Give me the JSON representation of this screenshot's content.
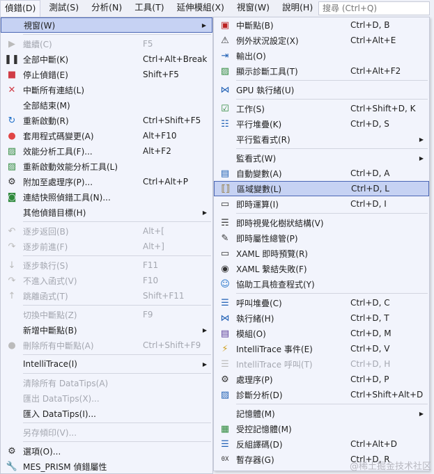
{
  "menubar": [
    "偵錯(D)",
    "測試(S)",
    "分析(N)",
    "工具(T)",
    "延伸模組(X)",
    "視窗(W)",
    "說明(H)"
  ],
  "search": {
    "placeholder": "搜尋 (Ctrl+Q)"
  },
  "left_menu": [
    {
      "label": "視窗(W)",
      "icon": "",
      "submenu": true,
      "highlight": true
    },
    {
      "sep": true
    },
    {
      "label": "繼續(C)",
      "shortcut": "F5",
      "icon": "play-icon",
      "disabled": true
    },
    {
      "label": "全部中斷(K)",
      "shortcut": "Ctrl+Alt+Break",
      "icon": "pause-icon"
    },
    {
      "label": "停止偵錯(E)",
      "shortcut": "Shift+F5",
      "icon": "stop-icon"
    },
    {
      "label": "中斷所有連結(L)",
      "icon": "close-icon"
    },
    {
      "label": "全部結束(M)",
      "icon": ""
    },
    {
      "label": "重新啟動(R)",
      "shortcut": "Ctrl+Shift+F5",
      "icon": "restart-icon"
    },
    {
      "label": "套用程式碼變更(A)",
      "shortcut": "Alt+F10",
      "icon": "hot-reload-icon"
    },
    {
      "label": "效能分析工具(F)...",
      "shortcut": "Alt+F2",
      "icon": "profiler-icon"
    },
    {
      "label": "重新啟動效能分析工具(L)",
      "icon": "profiler-icon"
    },
    {
      "label": "附加至處理序(P)...",
      "shortcut": "Ctrl+Alt+P",
      "icon": "gears-icon"
    },
    {
      "label": "連結快照偵錯工具(N)...",
      "icon": "snapshot-icon"
    },
    {
      "label": "其他偵錯目標(H)",
      "icon": "",
      "submenu": true
    },
    {
      "sep": true
    },
    {
      "label": "逐步返回(B)",
      "shortcut": "Alt+[",
      "icon": "step-back-icon",
      "disabled": true
    },
    {
      "label": "逐步前進(F)",
      "shortcut": "Alt+]",
      "icon": "step-forward-icon",
      "disabled": true
    },
    {
      "sep": true
    },
    {
      "label": "逐步執行(S)",
      "shortcut": "F11",
      "icon": "step-into-icon",
      "disabled": true
    },
    {
      "label": "不進入函式(V)",
      "shortcut": "F10",
      "icon": "step-over-icon",
      "disabled": true
    },
    {
      "label": "跳離函式(T)",
      "shortcut": "Shift+F11",
      "icon": "step-out-icon",
      "disabled": true
    },
    {
      "sep": true
    },
    {
      "label": "切換中斷點(Z)",
      "shortcut": "F9",
      "icon": "",
      "disabled": true
    },
    {
      "label": "新增中斷點(B)",
      "icon": "",
      "submenu": true
    },
    {
      "label": "刪除所有中斷點(A)",
      "shortcut": "Ctrl+Shift+F9",
      "icon": "delete-breakpoints-icon",
      "disabled": true
    },
    {
      "sep": true
    },
    {
      "label": "IntelliTrace(I)",
      "icon": "",
      "submenu": true
    },
    {
      "sep": true
    },
    {
      "label": "清除所有 DataTips(A)",
      "icon": "",
      "disabled": true
    },
    {
      "label": "匯出 DataTips(X)...",
      "icon": "",
      "disabled": true
    },
    {
      "label": "匯入 DataTips(I)...",
      "icon": ""
    },
    {
      "sep": true
    },
    {
      "label": "另存傾印(V)...",
      "icon": "",
      "disabled": true
    },
    {
      "sep": true
    },
    {
      "label": "選項(O)...",
      "icon": "gear-icon"
    },
    {
      "label": "MES_PRISM 偵錯屬性",
      "icon": "wrench-icon"
    }
  ],
  "right_menu": [
    {
      "label": "中斷點(B)",
      "shortcut": "Ctrl+D, B",
      "icon": "breakpoints-icon"
    },
    {
      "label": "例外狀況設定(X)",
      "shortcut": "Ctrl+Alt+E",
      "icon": "exception-settings-icon"
    },
    {
      "label": "輸出(O)",
      "icon": "output-icon"
    },
    {
      "label": "顯示診斷工具(T)",
      "shortcut": "Ctrl+Alt+F2",
      "icon": "diagnostics-icon"
    },
    {
      "sep": true
    },
    {
      "label": "GPU 執行緒(U)",
      "icon": "threads-icon"
    },
    {
      "sep": true
    },
    {
      "label": "工作(S)",
      "shortcut": "Ctrl+Shift+D, K",
      "icon": "tasks-icon"
    },
    {
      "label": "平行堆疊(K)",
      "shortcut": "Ctrl+D, S",
      "icon": "parallel-stacks-icon"
    },
    {
      "label": "平行監看式(R)",
      "icon": "",
      "submenu": true
    },
    {
      "sep": true
    },
    {
      "label": "監看式(W)",
      "icon": "",
      "submenu": true
    },
    {
      "label": "自動變數(A)",
      "shortcut": "Ctrl+D, A",
      "icon": "autos-icon"
    },
    {
      "label": "區域變數(L)",
      "shortcut": "Ctrl+D, L",
      "icon": "locals-icon",
      "highlight": true
    },
    {
      "label": "即時運算(I)",
      "shortcut": "Ctrl+D, I",
      "icon": "immediate-icon"
    },
    {
      "sep": true
    },
    {
      "label": "即時視覺化樹狀結構(V)",
      "icon": "visual-tree-icon"
    },
    {
      "label": "即時屬性總管(P)",
      "icon": "property-explorer-icon"
    },
    {
      "label": "XAML 即時預覽(R)",
      "icon": "preview-icon"
    },
    {
      "label": "XAML 繫結失敗(F)",
      "icon": "binding-failure-icon"
    },
    {
      "label": "協助工具檢查程式(Y)",
      "icon": "accessibility-icon"
    },
    {
      "sep": true
    },
    {
      "label": "呼叫堆疊(C)",
      "shortcut": "Ctrl+D, C",
      "icon": "call-stack-icon"
    },
    {
      "label": "執行緒(H)",
      "shortcut": "Ctrl+D, T",
      "icon": "threads-icon"
    },
    {
      "label": "模組(O)",
      "shortcut": "Ctrl+D, M",
      "icon": "modules-icon"
    },
    {
      "label": "IntelliTrace 事件(E)",
      "shortcut": "Ctrl+D, V",
      "icon": "lightning-icon"
    },
    {
      "label": "IntelliTrace 呼叫(T)",
      "shortcut": "Ctrl+D, H",
      "icon": "call-stack-icon",
      "disabled": true
    },
    {
      "label": "處理序(P)",
      "shortcut": "Ctrl+D, P",
      "icon": "gears-icon"
    },
    {
      "label": "診斷分析(D)",
      "shortcut": "Ctrl+Shift+Alt+D",
      "icon": "diagnostic-analysis-icon"
    },
    {
      "sep": true
    },
    {
      "label": "記憶體(M)",
      "icon": "",
      "submenu": true
    },
    {
      "label": "受控記憶體(M)",
      "icon": "managed-memory-icon"
    },
    {
      "label": "反組譯碼(D)",
      "shortcut": "Ctrl+Alt+D",
      "icon": "disassembly-icon"
    },
    {
      "label": "暫存器(G)",
      "shortcut": "Ctrl+D, R",
      "icon": "registers-icon"
    }
  ],
  "watermark": "@稀土掘金技术社区"
}
